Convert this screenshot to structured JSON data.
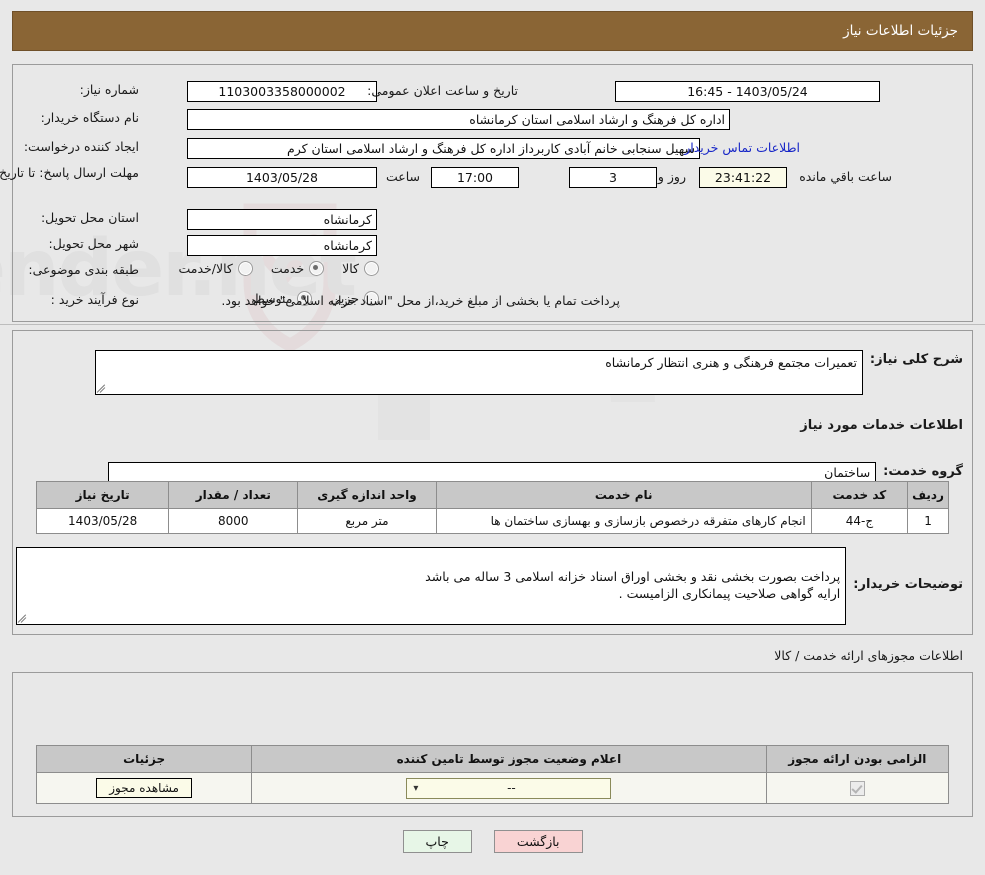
{
  "header": {
    "title": "جزئیات اطلاعات نیاز"
  },
  "top_form": {
    "need_number_label": "شماره نیاز:",
    "need_number_value": "1103003358000002",
    "announce_datetime_label": "تاریخ و ساعت اعلان عمومی:",
    "announce_datetime_value": "1403/05/24 - 16:45",
    "buyer_org_label": "نام دستگاه خریدار:",
    "buyer_org_value": "اداره کل فرهنگ و ارشاد اسلامی استان کرمانشاه",
    "requester_label": "ایجاد کننده درخواست:",
    "requester_value": "سهیل سنجابی خانم آبادی کاربرداز اداره کل فرهنگ و ارشاد اسلامی استان کرم",
    "buyer_contact_link": "اطلاعات تماس خریدار",
    "deadline_label": "مهلت ارسال پاسخ: تا تاریخ:",
    "deadline_date": "1403/05/28",
    "hour_label": "ساعت",
    "deadline_time": "17:00",
    "days_remaining": "3",
    "days_word": "روز و",
    "time_remaining": "23:41:22",
    "hours_remaining_label": "ساعت باقي مانده",
    "province_label": "استان محل تحویل:",
    "province_value": "کرمانشاه",
    "city_label": "شهر محل تحویل:",
    "city_value": "کرمانشاه",
    "category_label": "طبقه بندی موضوعی:",
    "category_options": [
      {
        "label": "کالا",
        "checked": false
      },
      {
        "label": "خدمت",
        "checked": true
      },
      {
        "label": "کالا/خدمت",
        "checked": false
      }
    ],
    "process_label": "نوع فرآیند خرید :",
    "process_options": [
      {
        "label": "جزیي",
        "checked": false
      },
      {
        "label": "متوسط",
        "checked": true
      }
    ],
    "process_note": "پرداخت تمام یا بخشی از مبلغ خرید،از محل \"اسناد خزانه اسلامی\" خواهد بود."
  },
  "middle": {
    "general_desc_label": "شرح کلی نیاز:",
    "general_desc_value": "تعمیرات مجتمع فرهنگی و هنری انتظار کرمانشاه",
    "services_section_title": "اطلاعات خدمات مورد نیاز",
    "service_group_label": "گروه خدمت:",
    "service_group_value": "ساختمان",
    "table": {
      "headers": [
        "ردیف",
        "کد خدمت",
        "نام خدمت",
        "واحد اندازه گیری",
        "تعداد / مقدار",
        "تاریخ نیاز"
      ],
      "rows": [
        {
          "row": "1",
          "code": "ج-44",
          "name": "انجام کارهای متفرقه درخصوص بازسازی و بهسازی ساختمان ها",
          "unit": "متر مربع",
          "quantity": "8000",
          "date": "1403/05/28"
        }
      ]
    },
    "buyer_notes_label": "توضیحات خریدار:",
    "buyer_notes_value": "پرداخت بصورت بخشی نقد و بخشی اوراق اسناد خزانه اسلامی 3 ساله  می باشد\nارایه گواهی صلاحیت پیمانکاری الزامیست ."
  },
  "permits": {
    "section_title": "اطلاعات مجوزهای ارائه خدمت / کالا",
    "headers": [
      "الزامی بودن ارائه مجوز",
      "اعلام وضعیت مجوز توسط تامین کننده",
      "جزئیات"
    ],
    "rows": [
      {
        "required_checked": true,
        "status_value": "--",
        "details_button": "مشاهده مجوز"
      }
    ]
  },
  "footer": {
    "print_label": "چاپ",
    "back_label": "بازگشت"
  },
  "colors": {
    "header_bg": "#8a6535",
    "page_bg": "#e8e8e8",
    "link": "#1726c7",
    "print_btn": "#e7f6e7",
    "back_btn": "#f9d3d3",
    "table_header": "#c8c8c8"
  },
  "watermark": {
    "text": "AriaTender.net"
  }
}
